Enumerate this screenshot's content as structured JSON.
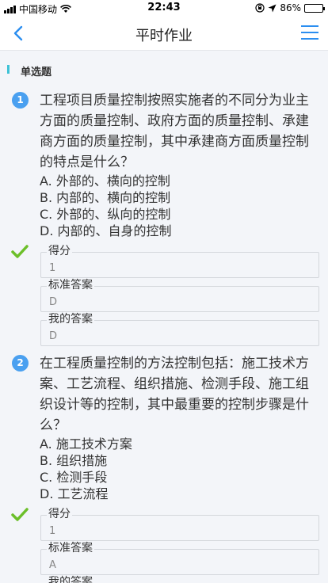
{
  "status_bar": {
    "carrier": "中国移动",
    "time": "22:43",
    "battery": "86%",
    "battery_level": 0.86
  },
  "nav": {
    "title": "平时作业"
  },
  "section": {
    "title": "单选题"
  },
  "questions": [
    {
      "number": "1",
      "text": "工程项目质量控制按照实施者的不同分为业主方面的质量控制、政府方面的质量控制、承建商方面的质量控制，其中承建商方面质量控制的特点是什么？",
      "options": [
        "A. 外部的、横向的控制",
        "B. 内部的、横向的控制",
        "C. 外部的、纵向的控制",
        "D. 内部的、自身的控制"
      ],
      "score_label": "得分",
      "score": "1",
      "standard_label": "标准答案",
      "standard": "D",
      "mine_label": "我的答案",
      "mine": "D"
    },
    {
      "number": "2",
      "text": "在工程质量控制的方法控制包括：施工技术方案、工艺流程、组织措施、检测手段、施工组织设计等的控制，其中最重要的控制步骤是什么？",
      "options": [
        "A. 施工技术方案",
        "B. 组织措施",
        "C. 检测手段",
        "D. 工艺流程"
      ],
      "score_label": "得分",
      "score": "1",
      "standard_label": "标准答案",
      "standard": "A",
      "mine_label": "我的答案"
    }
  ]
}
